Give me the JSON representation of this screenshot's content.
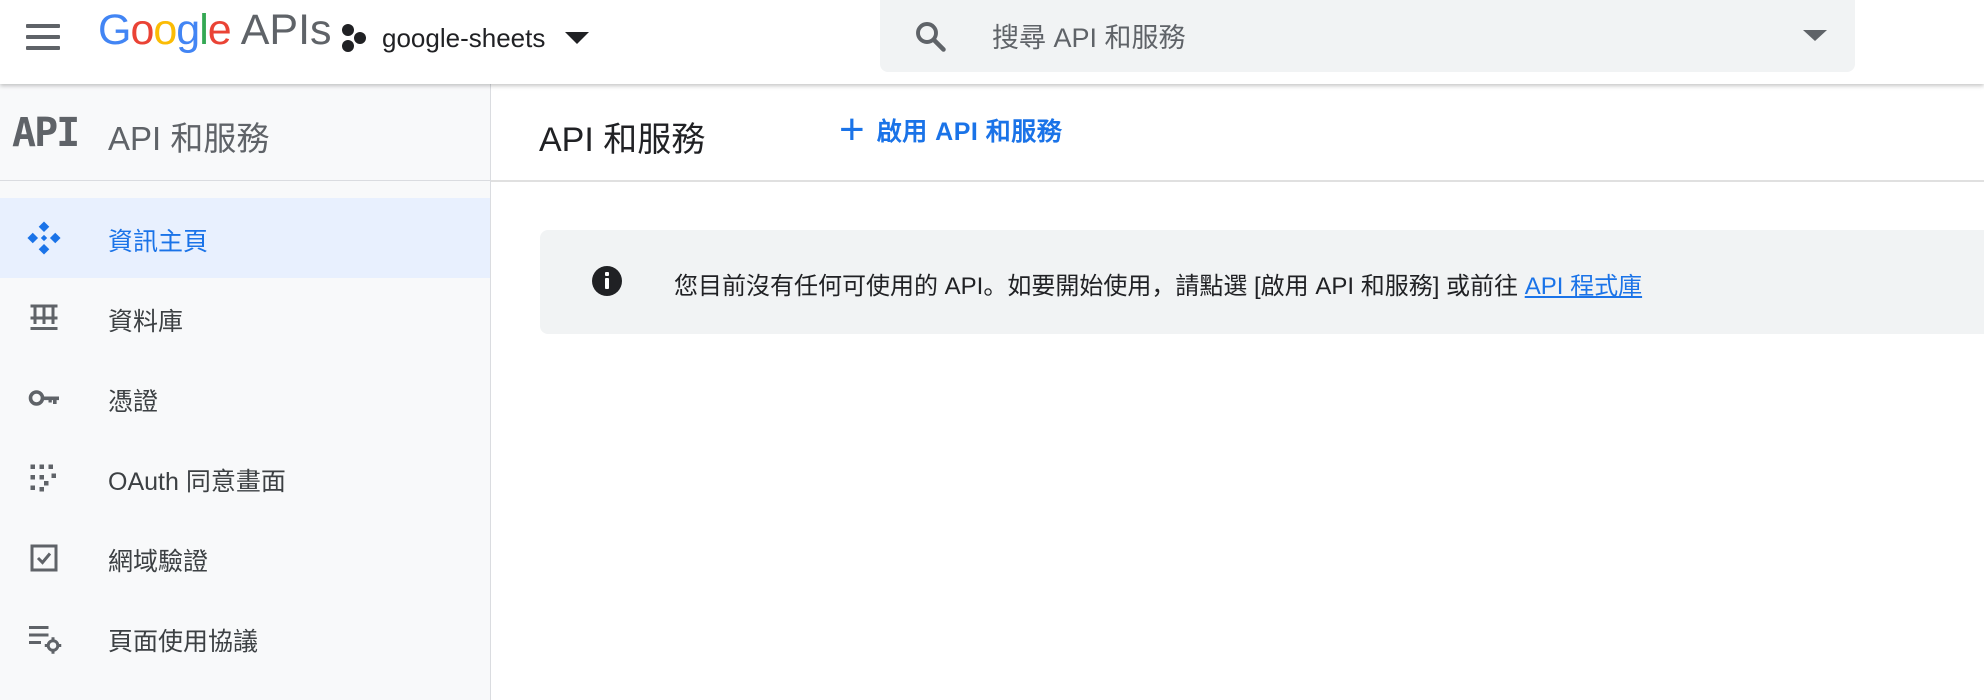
{
  "header": {
    "logo": {
      "letters": [
        "G",
        "o",
        "o",
        "g",
        "l",
        "e"
      ],
      "apis": "APIs"
    },
    "project": {
      "name": "google-sheets",
      "icon": "project-hexagons-icon"
    },
    "search": {
      "placeholder": "搜尋 API 和服務",
      "icon": "search-icon"
    }
  },
  "sidebar": {
    "logo_text": "API",
    "title": "API 和服務",
    "items": [
      {
        "label": "資訊主頁",
        "icon": "dashboard-icon",
        "active": true
      },
      {
        "label": "資料庫",
        "icon": "library-icon",
        "active": false
      },
      {
        "label": "憑證",
        "icon": "key-icon",
        "active": false
      },
      {
        "label": "OAuth 同意畫面",
        "icon": "oauth-consent-icon",
        "active": false
      },
      {
        "label": "網域驗證",
        "icon": "checkbox-icon",
        "active": false
      },
      {
        "label": "頁面使用協議",
        "icon": "settings-list-icon",
        "active": false
      }
    ]
  },
  "main": {
    "title": "API 和服務",
    "enable_button": {
      "plus": "+",
      "label": "啟用 API 和服務"
    },
    "notice": {
      "text": "您目前沒有任何可使用的 API。如要開始使用，請點選 [啟用 API 和服務] 或前往 ",
      "link": "API 程式庫"
    }
  },
  "colors": {
    "accent": "#1a73e8",
    "active_bg": "#e8f0fe",
    "sidebar_bg": "#f8f9fa",
    "search_bg": "#f1f3f4"
  }
}
